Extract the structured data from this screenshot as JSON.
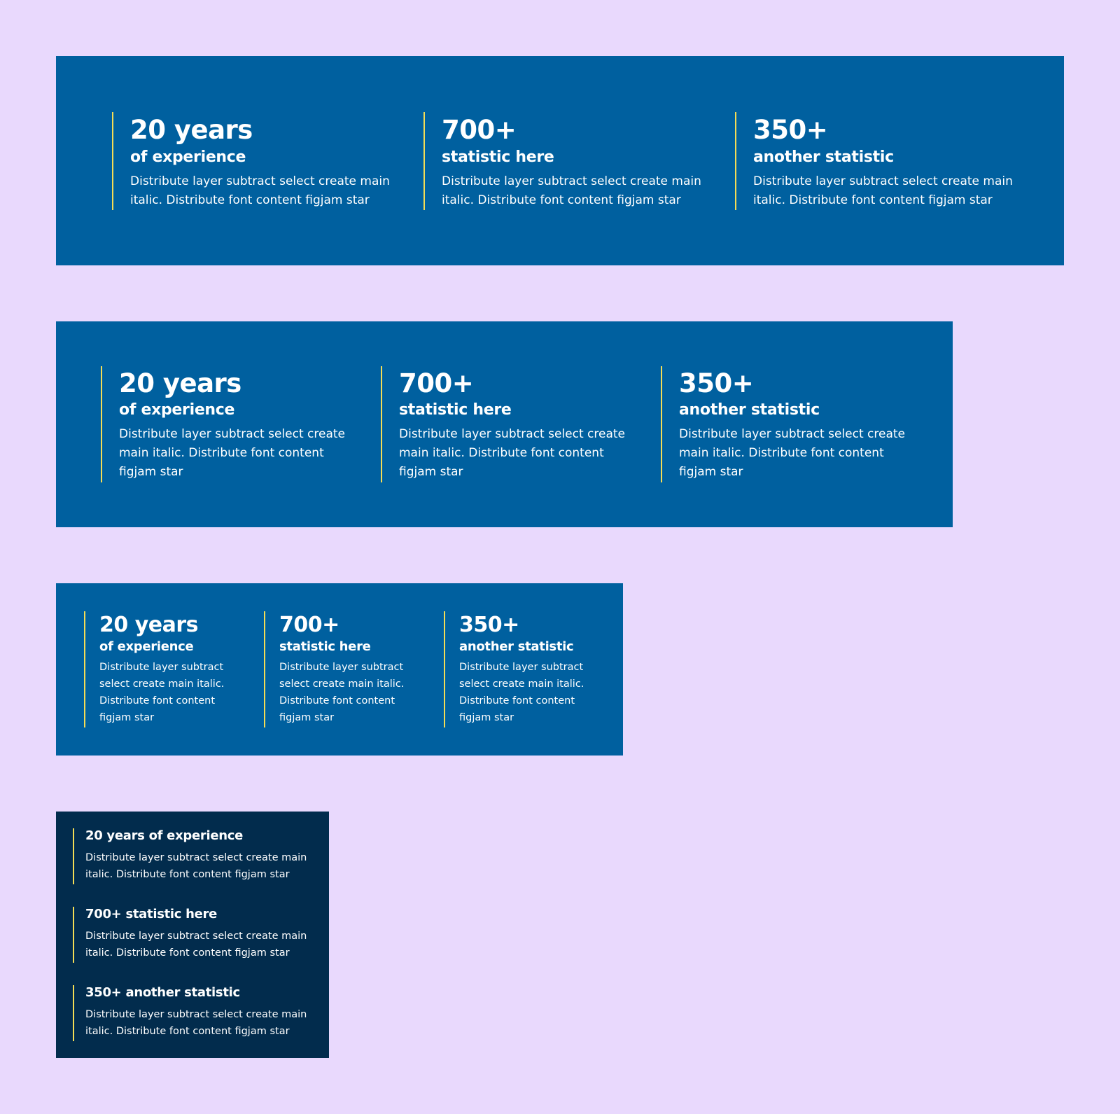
{
  "colors": {
    "page_background": "#e9d9fd",
    "panel_blue": "#00609f",
    "panel_dark": "#022c4d",
    "accent_line": "#f4dc55",
    "text": "#ffffff"
  },
  "panels": [
    {
      "stats": [
        {
          "number": "20 years",
          "label": "of experience",
          "description": "Distribute layer subtract select create main italic. Distribute font content figjam star"
        },
        {
          "number": "700+",
          "label": "statistic here",
          "description": "Distribute layer subtract select create main italic. Distribute font content figjam star"
        },
        {
          "number": "350+",
          "label": "another statistic",
          "description": "Distribute layer subtract select create main italic. Distribute font content figjam star"
        }
      ]
    },
    {
      "stats": [
        {
          "number": "20 years",
          "label": "of experience",
          "description": "Distribute layer subtract select create main italic. Distribute font content figjam star"
        },
        {
          "number": "700+",
          "label": "statistic here",
          "description": "Distribute layer subtract select create main italic. Distribute font content figjam star"
        },
        {
          "number": "350+",
          "label": "another statistic",
          "description": "Distribute layer subtract select create main italic. Distribute font content figjam star"
        }
      ]
    },
    {
      "stats": [
        {
          "number": "20 years",
          "label": "of experience",
          "description": "Distribute layer subtract select create main italic. Distribute font content figjam star"
        },
        {
          "number": "700+",
          "label": "statistic here",
          "description": "Distribute layer subtract select create main italic. Distribute font content figjam star"
        },
        {
          "number": "350+",
          "label": "another statistic",
          "description": "Distribute layer subtract select create main italic. Distribute font content figjam star"
        }
      ]
    },
    {
      "stats": [
        {
          "number": "20 years",
          "label": "of experience",
          "description": "Distribute layer subtract select create main italic. Distribute font content figjam star"
        },
        {
          "number": "700+",
          "label": "statistic here",
          "description": "Distribute layer subtract select create main italic. Distribute font content figjam star"
        },
        {
          "number": "350+",
          "label": "another statistic",
          "description": "Distribute layer subtract select create main italic. Distribute font content figjam star"
        }
      ]
    }
  ]
}
